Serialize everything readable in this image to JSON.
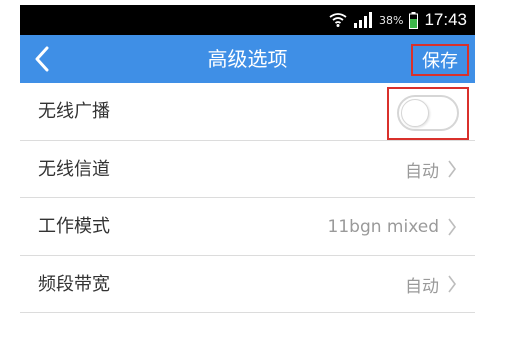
{
  "status_bar": {
    "battery_percent": "38%",
    "time": "17:43",
    "icons": [
      "wifi-icon",
      "signal-icon",
      "battery-icon"
    ],
    "battery_color": "#3cb64a"
  },
  "header": {
    "title": "高级选项",
    "save_label": "保存",
    "back_icon": "chevron-left-icon",
    "background_color": "#3f8fe6"
  },
  "settings": {
    "wireless_broadcast": {
      "label": "无线广播",
      "enabled": false
    },
    "wireless_channel": {
      "label": "无线信道",
      "value": "自动"
    },
    "work_mode": {
      "label": "工作模式",
      "value": "11bgn mixed"
    },
    "bandwidth": {
      "label": "频段带宽",
      "value": "自动"
    }
  },
  "highlight_color": "#d9302b"
}
